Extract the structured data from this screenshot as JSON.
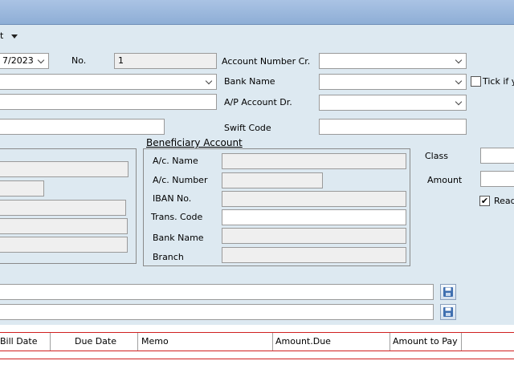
{
  "toolbar": {
    "menu_label": "t"
  },
  "header": {
    "date_value": "7/2023",
    "no_label": "No.",
    "no_value": "1",
    "account_number_cr_label": "Account Number Cr.",
    "bank_name_label": "Bank Name",
    "ap_account_dr_label": "A/P Account Dr.",
    "swift_code_label": "Swift Code",
    "tick_label": "Tick if yo"
  },
  "beneficiary": {
    "title": "Beneficiary Account",
    "ac_name_label": "A/c. Name",
    "ac_number_label": "A/c. Number",
    "iban_label": "IBAN No.",
    "trans_code_label": "Trans. Code",
    "bank_name_label": "Bank Name",
    "branch_label": "Branch"
  },
  "right_panel": {
    "class_label": "Class",
    "amount_label": "Amount",
    "ready_label": "Read",
    "ready_checked": true
  },
  "grid": {
    "columns": [
      "Bill Date",
      "Due Date",
      "Memo",
      "Amount.Due",
      "Amount to Pay",
      ""
    ]
  },
  "colors": {
    "form_background": "#dde9f1",
    "grid_border": "#d02020",
    "titlebar": "#8eaed6"
  }
}
